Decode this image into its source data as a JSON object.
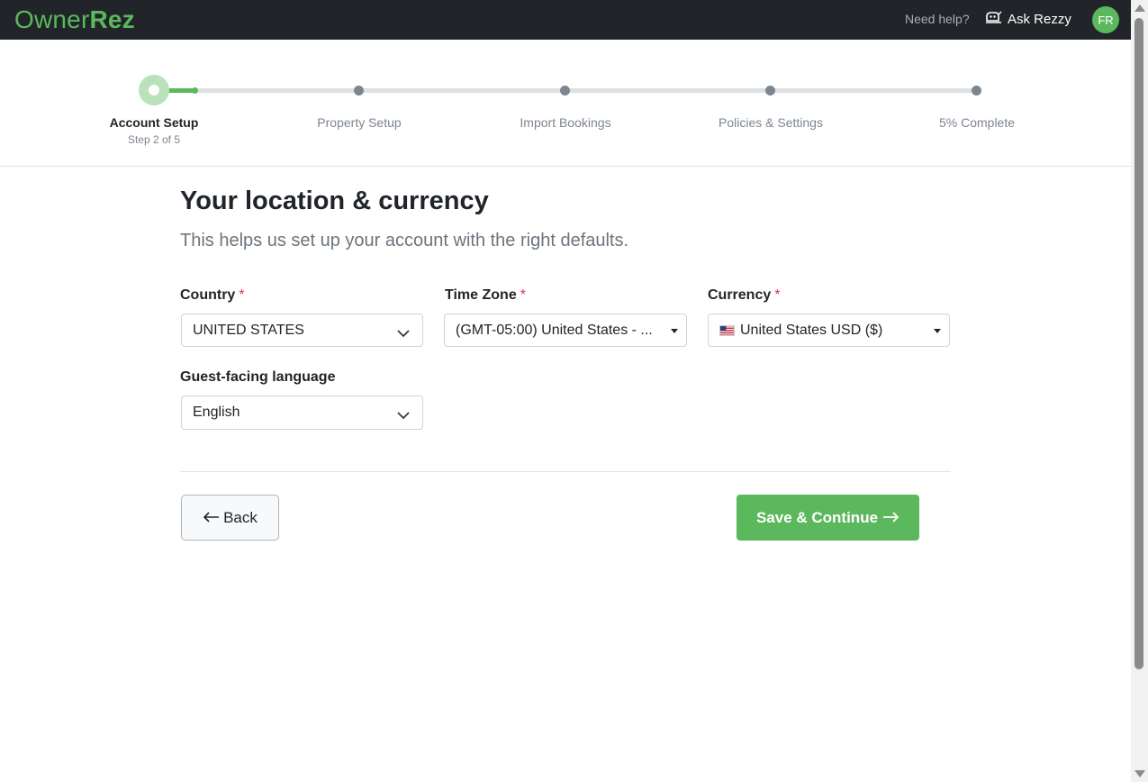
{
  "header": {
    "logo_owner": "Owner",
    "logo_rez": "Rez",
    "help_text": "Need help?",
    "ask_label": "Ask Rezzy",
    "avatar_initials": "FR"
  },
  "stepper": {
    "steps": [
      {
        "label": "Account Setup",
        "sub": "Step 2 of 5"
      },
      {
        "label": "Property Setup"
      },
      {
        "label": "Import Bookings"
      },
      {
        "label": "Policies & Settings"
      },
      {
        "label": "5% Complete"
      }
    ],
    "progress_fraction": 0.05
  },
  "page": {
    "title": "Your location & currency",
    "subtitle": "This helps us set up your account with the right defaults."
  },
  "form": {
    "country": {
      "label": "Country",
      "required_mark": "*",
      "value": "UNITED STATES"
    },
    "timezone": {
      "label": "Time Zone",
      "required_mark": "*",
      "value": "(GMT-05:00) United States - ..."
    },
    "currency": {
      "label": "Currency",
      "required_mark": "*",
      "value": "United States USD ($)",
      "flag_icon": "us-flag-icon"
    },
    "language": {
      "label": "Guest-facing language",
      "value": "English"
    }
  },
  "actions": {
    "back_label": "Back",
    "save_label": "Save & Continue"
  },
  "colors": {
    "brand_green": "#5cb85c",
    "nav_bg": "#212529",
    "required": "#dc3545"
  }
}
